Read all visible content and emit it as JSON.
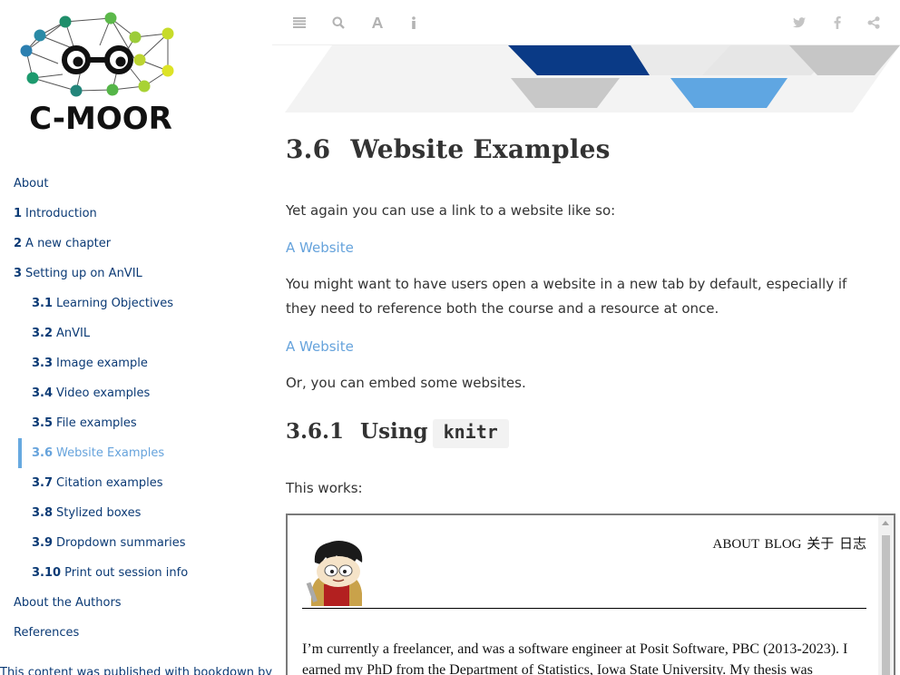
{
  "logo": {
    "text": "C-MOOR"
  },
  "toolbar": {
    "left_icons": [
      "menu-icon",
      "search-icon",
      "font-icon",
      "info-icon"
    ],
    "right_icons": [
      "twitter-icon",
      "facebook-icon",
      "share-icon"
    ]
  },
  "sidebar": {
    "items": [
      {
        "num": "",
        "label": "About",
        "level": 1,
        "active": false
      },
      {
        "num": "1",
        "label": "Introduction",
        "level": 1,
        "active": false
      },
      {
        "num": "2",
        "label": "A new chapter",
        "level": 1,
        "active": false
      },
      {
        "num": "3",
        "label": "Setting up on AnVIL",
        "level": 1,
        "active": false
      },
      {
        "num": "3.1",
        "label": "Learning Objectives",
        "level": 2,
        "active": false
      },
      {
        "num": "3.2",
        "label": "AnVIL",
        "level": 2,
        "active": false
      },
      {
        "num": "3.3",
        "label": "Image example",
        "level": 2,
        "active": false
      },
      {
        "num": "3.4",
        "label": "Video examples",
        "level": 2,
        "active": false
      },
      {
        "num": "3.5",
        "label": "File examples",
        "level": 2,
        "active": false
      },
      {
        "num": "3.6",
        "label": "Website Examples",
        "level": 2,
        "active": true
      },
      {
        "num": "3.7",
        "label": "Citation examples",
        "level": 2,
        "active": false
      },
      {
        "num": "3.8",
        "label": "Stylized boxes",
        "level": 2,
        "active": false
      },
      {
        "num": "3.9",
        "label": "Dropdown summaries",
        "level": 2,
        "active": false
      },
      {
        "num": "3.10",
        "label": "Print out session info",
        "level": 2,
        "active": false
      },
      {
        "num": "",
        "label": "About the Authors",
        "level": 1,
        "active": false
      },
      {
        "num": "",
        "label": "References",
        "level": 1,
        "active": false
      }
    ],
    "published": "This content was published with bookdown by:"
  },
  "main": {
    "section_num": "3.6",
    "section_title": "Website Examples",
    "para1": "Yet again you can use a link to a website like so:",
    "link1": "A Website",
    "para2": "You might want to have users open a website in a new tab by default, especially if they need to reference both the course and a resource at once.",
    "link2": "A Website",
    "para3": "Or, you can embed some websites.",
    "subsection_num": "3.6.1",
    "subsection_title": "Using",
    "subsection_code": "knitr",
    "para4": "This works:"
  },
  "iframe": {
    "nav": "ABOUT BLOG 关于 日志",
    "text": "I’m currently a freelancer, and was a software engineer at Posit Software, PBC (2013-2023). I earned my PhD from the Department of Statistics, Iowa State University. My thesis was"
  },
  "colors": {
    "link": "#66a3dc",
    "toc_text": "#0b3a75",
    "active_bar": "#67a9e0",
    "banner_navy": "#0a3a86",
    "banner_blue": "#5fa6e2",
    "banner_gray": "#c8c8c8"
  }
}
